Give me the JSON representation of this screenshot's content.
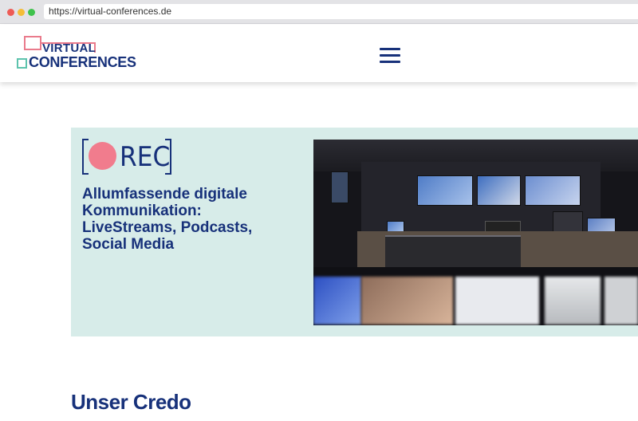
{
  "browser": {
    "url": "https://virtual-conferences.de"
  },
  "header": {
    "logo_line1": "VIRTUAL",
    "logo_line2": "CONFERENCES",
    "menu_icon": "hamburger-icon"
  },
  "hero": {
    "badge_text": "REC",
    "title": "Allumfassende digitale Kommunikation: LiveStreams, Podcasts, Social Media",
    "image": "broadcast-control-room-photo"
  },
  "section": {
    "heading": "Unser Credo"
  },
  "colors": {
    "brand_blue": "#17317a",
    "accent_pink": "#f17c8d",
    "accent_teal": "#5dc3ad",
    "hero_bg": "#d7ece9"
  }
}
